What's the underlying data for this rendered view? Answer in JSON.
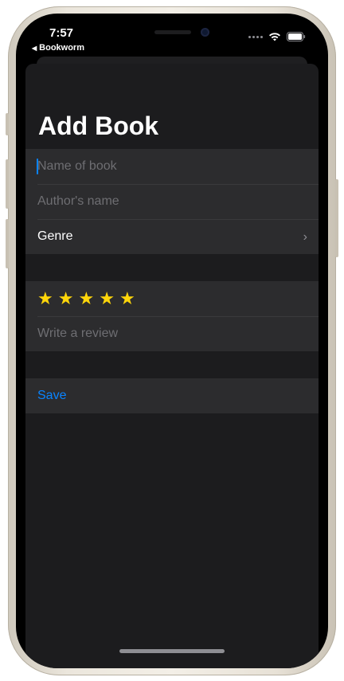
{
  "status_bar": {
    "time": "7:57",
    "back_app": "Bookworm",
    "icons": [
      "signal-dots-icon",
      "wifi-icon",
      "battery-icon"
    ]
  },
  "form": {
    "title": "Add Book",
    "name_placeholder": "Name of book",
    "author_placeholder": "Author's name",
    "genre_label": "Genre",
    "rating": 5,
    "rating_max": 5,
    "star_symbol": "★",
    "review_placeholder": "Write a review",
    "save_label": "Save"
  },
  "colors": {
    "accent": "#0a84ff",
    "star": "#ffd60a",
    "background": "#1c1c1e",
    "row": "#2c2c2e"
  }
}
